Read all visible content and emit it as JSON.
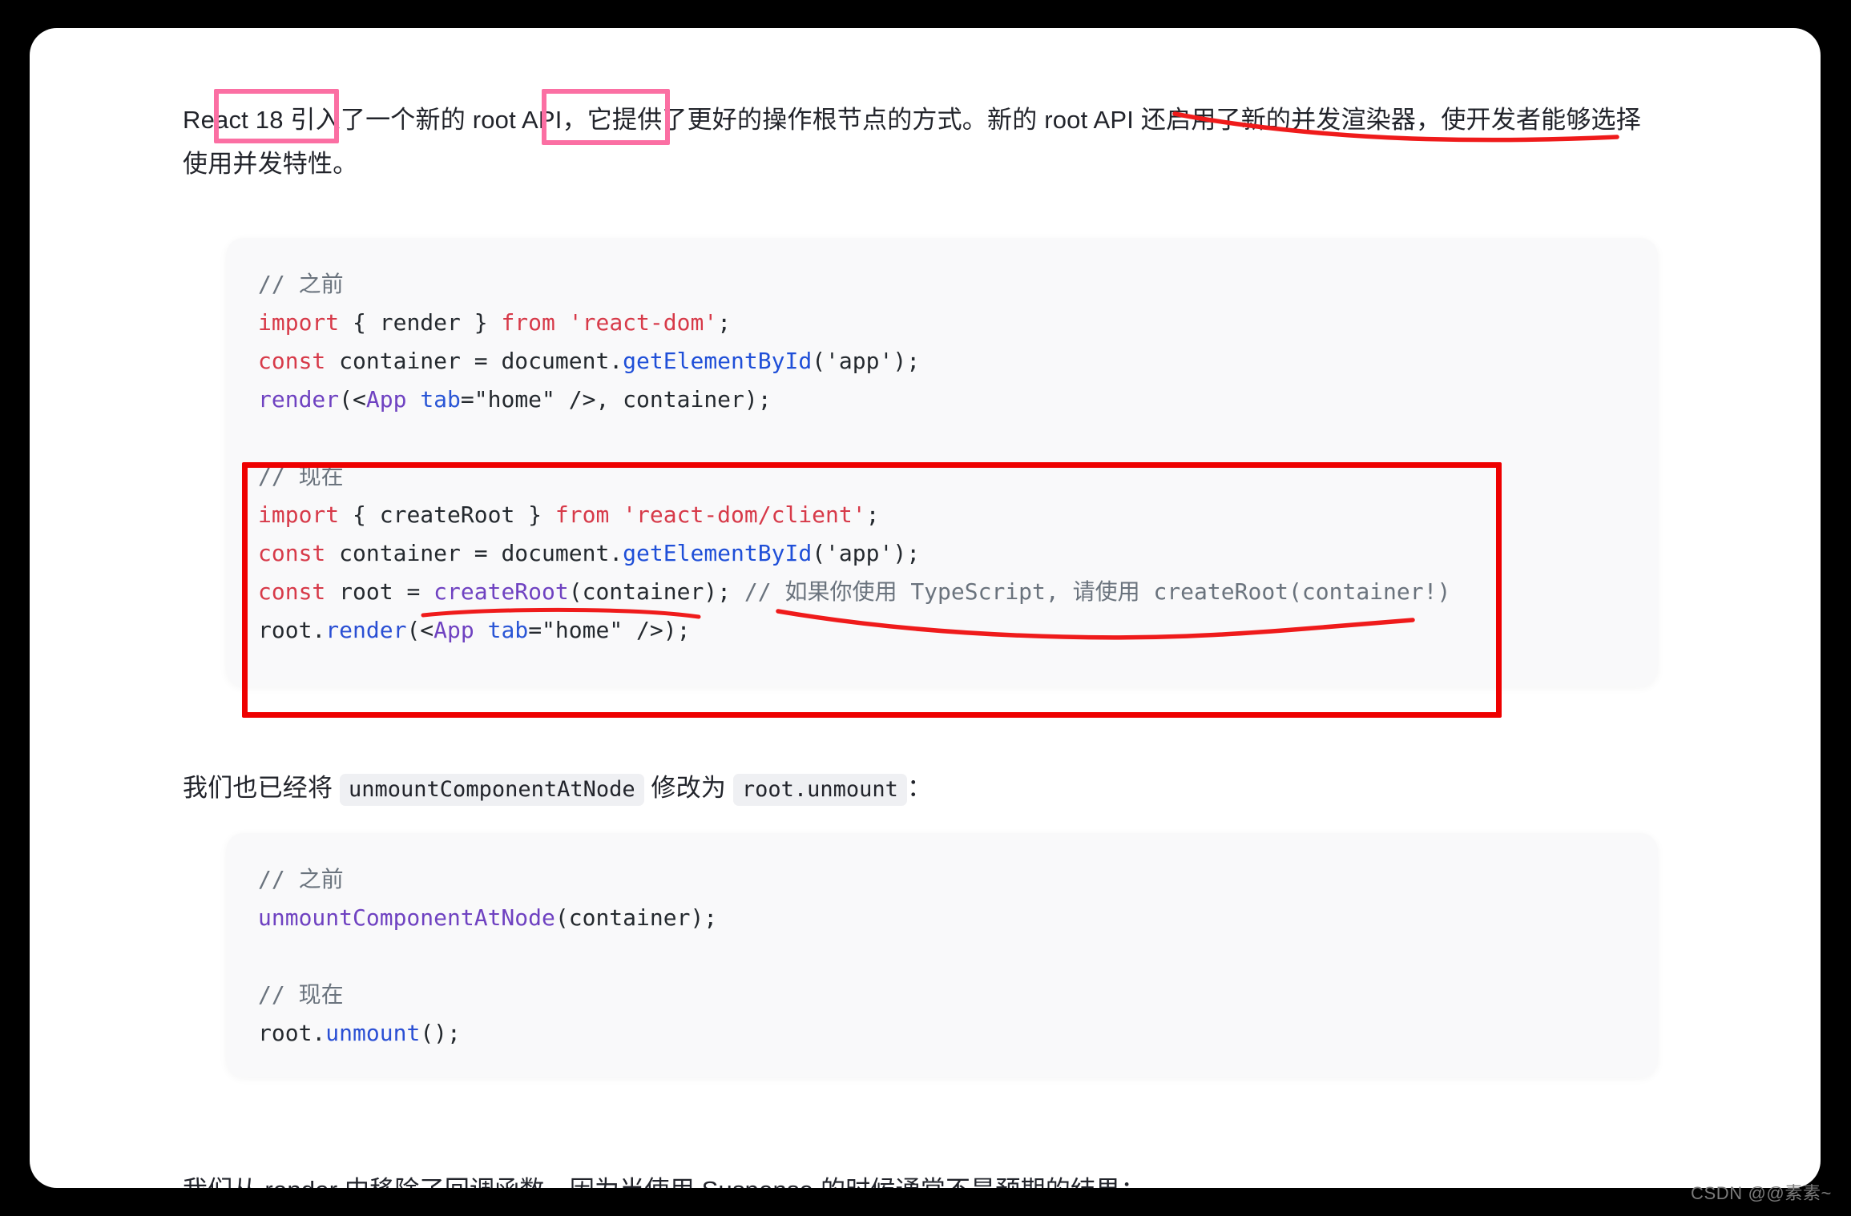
{
  "document": {
    "background_color": "#000000",
    "sheet_color": "#ffffff",
    "accent_pink": "#fb6fa3",
    "accent_red": "#ee0000",
    "code_bg": "#f9f9fa"
  },
  "paragraphs": {
    "intro": {
      "seg_react18": "React 18",
      "seg_a": " 引入了一个新的 ",
      "seg_rootapi": "root API",
      "seg_b": "，它提供了更好的操作根节点的方式。新的 root API 还启用了新的并发渲染器，使开发者能够选择使用并发特性。"
    },
    "unmount": {
      "seg_a": "我们也已经将 ",
      "code_1": "unmountComponentAtNode",
      "seg_b": " 修改为 ",
      "code_2": "root.unmount",
      "seg_c": "："
    },
    "callback": {
      "text": "我们从 render 中移除了回调函数，因为当使用 Suspense 的时候通常不是预期的结果："
    }
  },
  "code_block_1": {
    "lines": [
      {
        "id": "c1l1",
        "tokens": [
          {
            "t": "// 之前",
            "c": "tok-cmt"
          }
        ]
      },
      {
        "id": "c1l2",
        "tokens": [
          {
            "t": "import",
            "c": "tok-kw"
          },
          {
            "t": " { render } ",
            "c": "tok-plain"
          },
          {
            "t": "from",
            "c": "tok-kw"
          },
          {
            "t": " ",
            "c": "tok-plain"
          },
          {
            "t": "'react-dom'",
            "c": "tok-str"
          },
          {
            "t": ";",
            "c": "tok-plain"
          }
        ]
      },
      {
        "id": "c1l3",
        "tokens": [
          {
            "t": "const",
            "c": "tok-kw"
          },
          {
            "t": " container = document.",
            "c": "tok-plain"
          },
          {
            "t": "getElementById",
            "c": "tok-fn"
          },
          {
            "t": "(",
            "c": "tok-plain"
          },
          {
            "t": "'app'",
            "c": "tok-plain"
          },
          {
            "t": ");",
            "c": "tok-plain"
          }
        ]
      },
      {
        "id": "c1l4",
        "tokens": [
          {
            "t": "render",
            "c": "tok-purple"
          },
          {
            "t": "(<",
            "c": "tok-plain"
          },
          {
            "t": "App",
            "c": "tok-tag"
          },
          {
            "t": " ",
            "c": "tok-plain"
          },
          {
            "t": "tab",
            "c": "tok-attr"
          },
          {
            "t": "=\"home\" />, container);",
            "c": "tok-plain"
          }
        ]
      },
      {
        "id": "c1l5",
        "tokens": [
          {
            "t": " ",
            "c": "tok-plain"
          }
        ]
      },
      {
        "id": "c1l6",
        "tokens": [
          {
            "t": "// 现在",
            "c": "tok-cmt"
          }
        ]
      },
      {
        "id": "c1l7",
        "tokens": [
          {
            "t": "import",
            "c": "tok-kw"
          },
          {
            "t": " { createRoot } ",
            "c": "tok-plain"
          },
          {
            "t": "from",
            "c": "tok-kw"
          },
          {
            "t": " ",
            "c": "tok-plain"
          },
          {
            "t": "'react-dom/client'",
            "c": "tok-str"
          },
          {
            "t": ";",
            "c": "tok-plain"
          }
        ]
      },
      {
        "id": "c1l8",
        "tokens": [
          {
            "t": "const",
            "c": "tok-kw"
          },
          {
            "t": " container = document.",
            "c": "tok-plain"
          },
          {
            "t": "getElementById",
            "c": "tok-fn"
          },
          {
            "t": "(",
            "c": "tok-plain"
          },
          {
            "t": "'app'",
            "c": "tok-plain"
          },
          {
            "t": ");",
            "c": "tok-plain"
          }
        ]
      },
      {
        "id": "c1l9",
        "tokens": [
          {
            "t": "const",
            "c": "tok-kw"
          },
          {
            "t": " root = ",
            "c": "tok-plain"
          },
          {
            "t": "createRoot",
            "c": "tok-purple"
          },
          {
            "t": "(container); ",
            "c": "tok-plain"
          },
          {
            "t": "// 如果你使用 TypeScript, 请使用 createRoot(container!)",
            "c": "tok-cmt"
          }
        ]
      },
      {
        "id": "c1l10",
        "tokens": [
          {
            "t": "root.",
            "c": "tok-plain"
          },
          {
            "t": "render",
            "c": "tok-fn2"
          },
          {
            "t": "(<",
            "c": "tok-plain"
          },
          {
            "t": "App",
            "c": "tok-tag"
          },
          {
            "t": " ",
            "c": "tok-plain"
          },
          {
            "t": "tab",
            "c": "tok-attr"
          },
          {
            "t": "=\"home\" />);",
            "c": "tok-plain"
          }
        ]
      }
    ]
  },
  "code_block_2": {
    "lines": [
      {
        "id": "c2l1",
        "tokens": [
          {
            "t": "// 之前",
            "c": "tok-cmt"
          }
        ]
      },
      {
        "id": "c2l2",
        "tokens": [
          {
            "t": "unmountComponentAtNode",
            "c": "tok-purple"
          },
          {
            "t": "(container);",
            "c": "tok-plain"
          }
        ]
      },
      {
        "id": "c2l3",
        "tokens": [
          {
            "t": " ",
            "c": "tok-plain"
          }
        ]
      },
      {
        "id": "c2l4",
        "tokens": [
          {
            "t": "// 现在",
            "c": "tok-cmt"
          }
        ]
      },
      {
        "id": "c2l5",
        "tokens": [
          {
            "t": "root.",
            "c": "tok-plain"
          },
          {
            "t": "unmount",
            "c": "tok-fn2"
          },
          {
            "t": "();",
            "c": "tok-plain"
          }
        ]
      }
    ]
  },
  "annotations": {
    "pink_box_react18": "React 18",
    "pink_box_root_api": "root API",
    "red_box_label": "现在 code section",
    "red_underline_intro": "并发渲染器 underline",
    "red_underline_createroot": "createRoot(container) underline",
    "red_underline_comment": "TypeScript comment underline"
  },
  "watermark": {
    "text": "CSDN @@素素~"
  }
}
